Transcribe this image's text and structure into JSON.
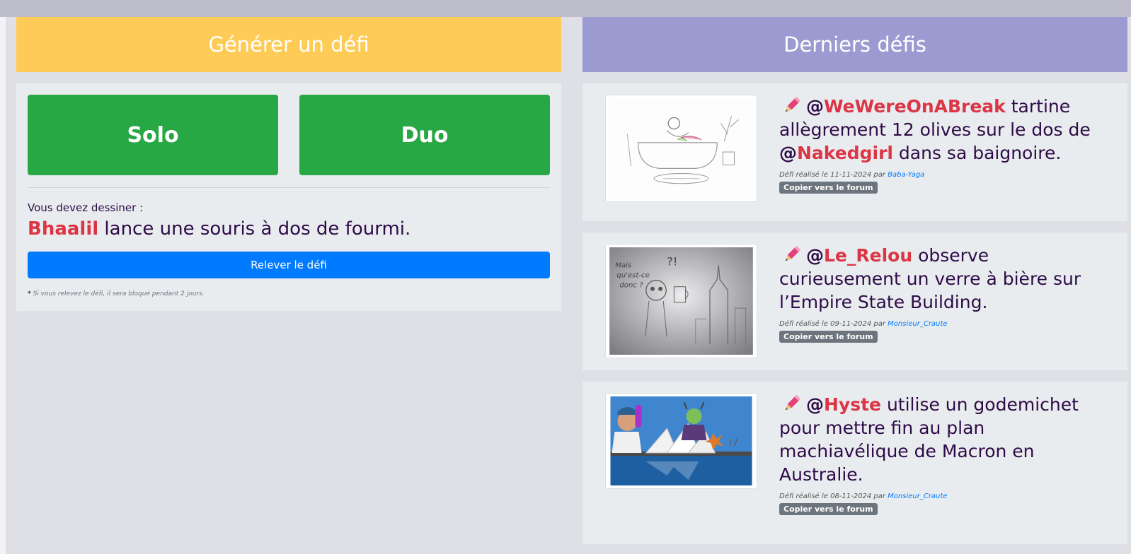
{
  "generate": {
    "title": "Générer un défi",
    "solo_label": "Solo",
    "duo_label": "Duo",
    "must_draw_label": "Vous devez dessiner :",
    "challenge_user": "Bhaalil",
    "challenge_text": " lance une souris à dos de fourmi.",
    "accept_label": "Relever le défi",
    "note_star": "*",
    "note_text": " Si vous relevez le défi, il sera bloqué pendant 2 jours."
  },
  "latest": {
    "title": "Derniers défis",
    "copy_label": "Copier vers le forum",
    "pencil_icon": "pencil-emoji-icon",
    "items": [
      {
        "user1": "WeWereOnABreak",
        "text1": " tartine allègrement 12 olives sur le dos de ",
        "user2": "Nakedgirl",
        "text2": " dans sa baignoire.",
        "meta_prefix": "Défi réalisé le 11-11-2024 par ",
        "author": "Baba-Yaga"
      },
      {
        "user1": "Le_Relou",
        "text1": " observe curieusement un verre à bière sur l’Empire State Building.",
        "meta_prefix": "Défi réalisé le 09-11-2024 par ",
        "author": "Monsieur_Craute"
      },
      {
        "user1": "Hyste",
        "text1": " utilise un godemichet pour mettre fin au plan machiavélique de Macron en Australie.",
        "meta_prefix": "Défi réalisé le 08-11-2024 par ",
        "author": "Monsieur_Craute"
      }
    ]
  },
  "colors": {
    "generate_header": "#ffcb57",
    "latest_header": "#9b9ad1",
    "green_button": "#28a745",
    "blue_button": "#007bff",
    "username_red": "#dc3545",
    "text_purple": "#2e0b47"
  }
}
